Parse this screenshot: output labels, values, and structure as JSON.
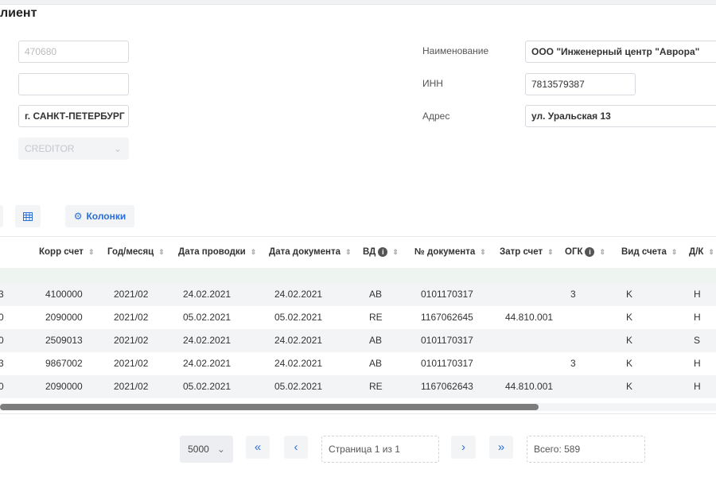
{
  "title": "лиент",
  "left_fields": {
    "postal": "470680",
    "empty": "",
    "city": "г. САНКТ-ПЕТЕРБУРГ",
    "type": "CREDITOR"
  },
  "right_fields": [
    {
      "label": "Наименование",
      "value": "ООО \"Инженерный центр \"Аврора\""
    },
    {
      "label": "ИНН",
      "value": "7813579387"
    },
    {
      "label": "Адрес",
      "value": "ул. Уральская 13"
    }
  ],
  "toolbar": {
    "columns_label": "Колонки"
  },
  "table": {
    "headers": [
      {
        "label": "",
        "info": false
      },
      {
        "label": "Корр счет",
        "info": false
      },
      {
        "label": "Год/месяц",
        "info": false
      },
      {
        "label": "Дата проводки",
        "info": false
      },
      {
        "label": "Дата документа",
        "info": false
      },
      {
        "label": "ВД",
        "info": true
      },
      {
        "label": "№ документа",
        "info": false
      },
      {
        "label": "Затр счет",
        "info": false
      },
      {
        "label": "ОГК",
        "info": true
      },
      {
        "label": "Вид счета",
        "info": false
      },
      {
        "label": "Д/К",
        "info": false
      }
    ],
    "rows": [
      [
        "3",
        "4100000",
        "2021/02",
        "24.02.2021",
        "24.02.2021",
        "AB",
        "0101170317",
        "",
        "3",
        "K",
        "H"
      ],
      [
        "0",
        "2090000",
        "2021/02",
        "05.02.2021",
        "05.02.2021",
        "RE",
        "1167062645",
        "44.810.001",
        "",
        "K",
        "H"
      ],
      [
        "0",
        "2509013",
        "2021/02",
        "24.02.2021",
        "24.02.2021",
        "AB",
        "0101170317",
        "",
        "",
        "K",
        "S"
      ],
      [
        "3",
        "9867002",
        "2021/02",
        "24.02.2021",
        "24.02.2021",
        "AB",
        "0101170317",
        "",
        "3",
        "K",
        "H"
      ],
      [
        "0",
        "2090000",
        "2021/02",
        "05.02.2021",
        "05.02.2021",
        "RE",
        "1167062643",
        "44.810.001",
        "",
        "K",
        "H"
      ]
    ]
  },
  "pagination": {
    "page_size": "5000",
    "first": "«",
    "prev": "‹",
    "page_text": "Страница 1 из 1",
    "next": "›",
    "last": "»",
    "total": "Всего: 589"
  }
}
